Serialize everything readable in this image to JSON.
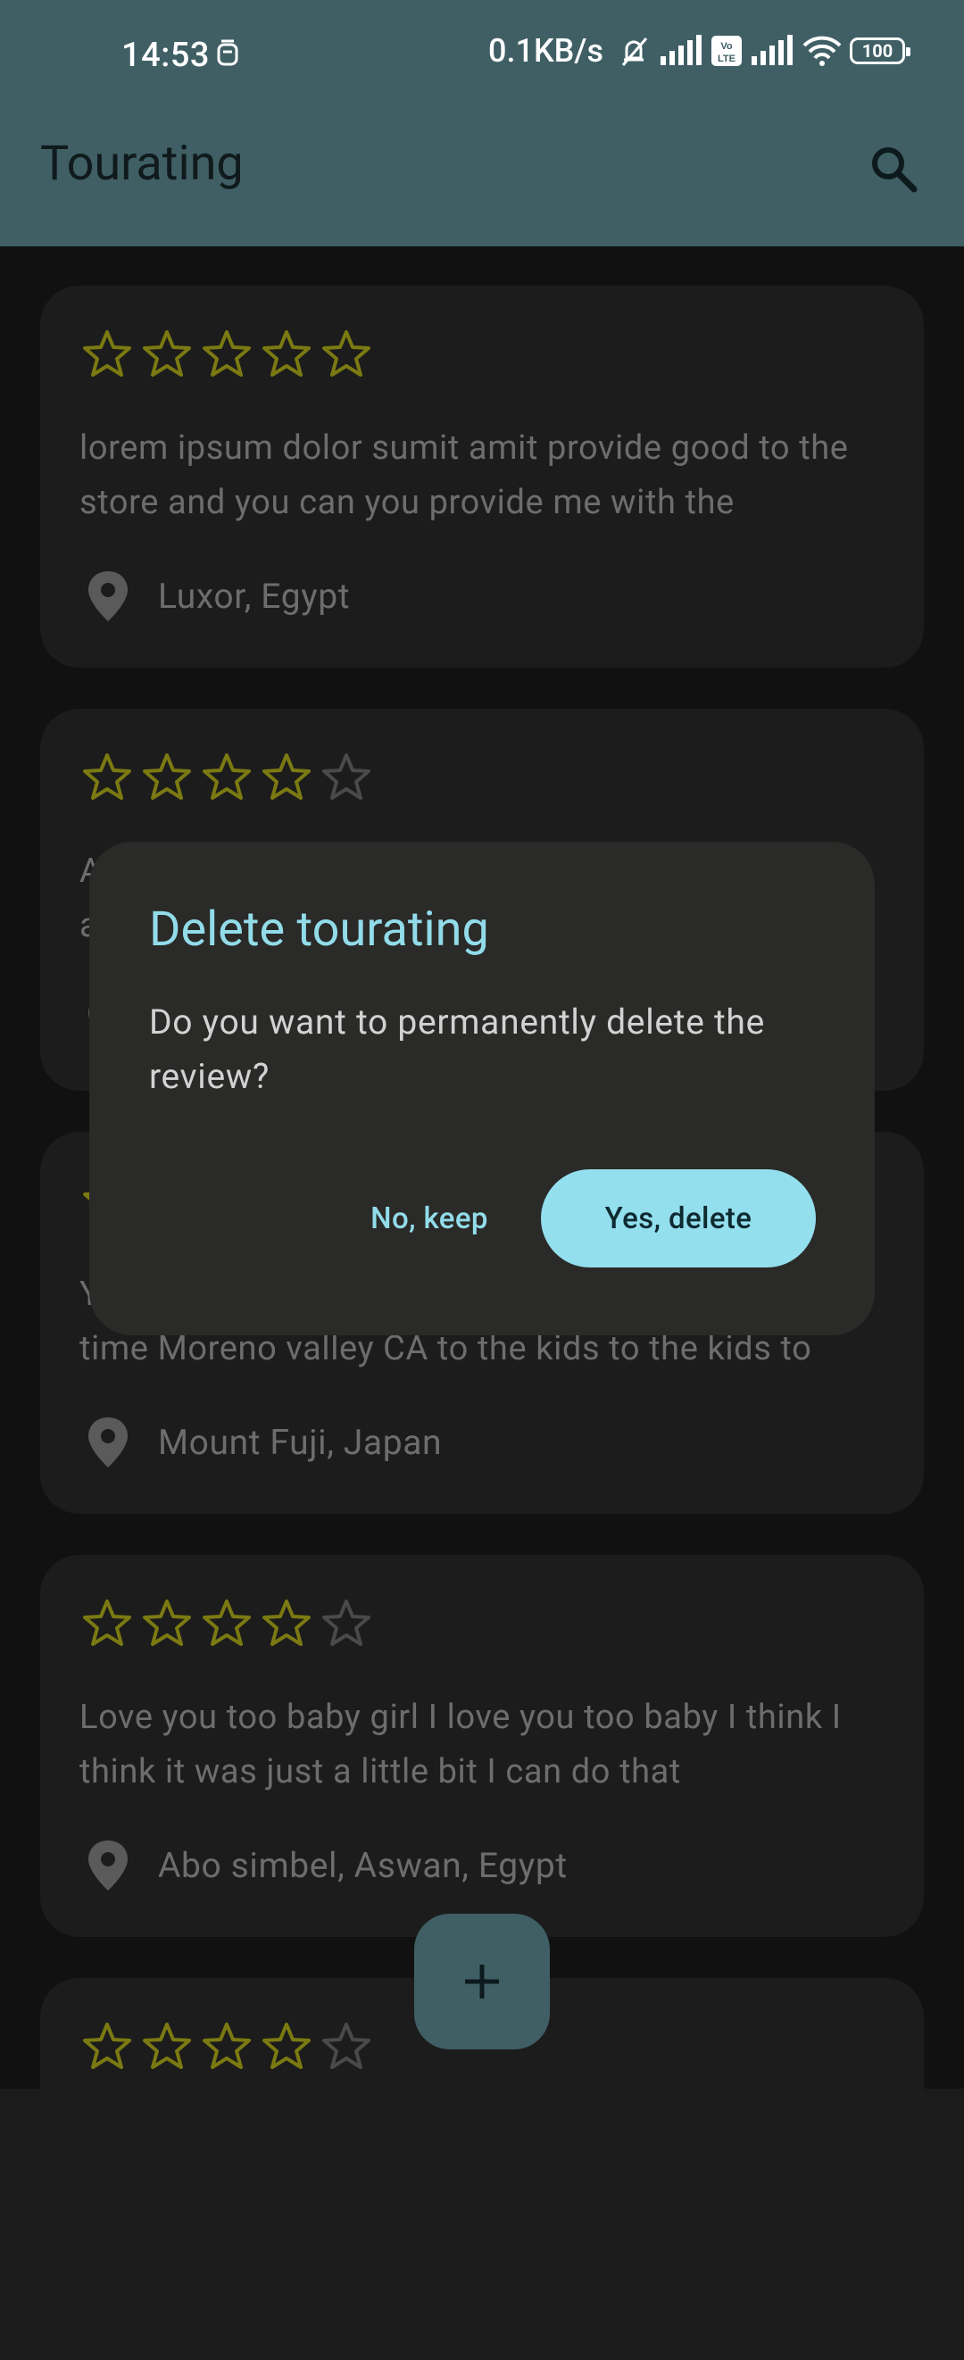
{
  "status": {
    "time": "14:53",
    "net_speed": "0.1KB/s",
    "battery": "100"
  },
  "app": {
    "title": "Tourating",
    "search_icon": "search-icon"
  },
  "reviews": [
    {
      "rating": 5,
      "text": "lorem ipsum dolor sumit amit provide good to the store and you can you provide me with the",
      "location": "Luxor, Egypt"
    },
    {
      "rating": 4,
      "text": "A",
      "text_line2": "a",
      "location": ""
    },
    {
      "rating": 4,
      "text": "Y",
      "text_line2": "time Moreno valley CA to the kids to the kids to",
      "location": "Mount Fuji, Japan"
    },
    {
      "rating": 4,
      "text": "Love you too baby girl I love you too baby I think I think it was just a little bit I can do that",
      "location": "Abo simbel, Aswan, Egypt"
    },
    {
      "rating": 4,
      "text": "",
      "location": ""
    }
  ],
  "dialog": {
    "title": "Delete tourating",
    "message": "Do you want to permanently delete the review?",
    "cancel_label": "No, keep",
    "confirm_label": "Yes, delete"
  },
  "fab": {
    "icon": "add-icon"
  },
  "colors": {
    "app_bar": "#3f5f65",
    "accent": "#92dcea",
    "star_filled": "#7b7a12",
    "star_empty": "#4a4a4a"
  }
}
